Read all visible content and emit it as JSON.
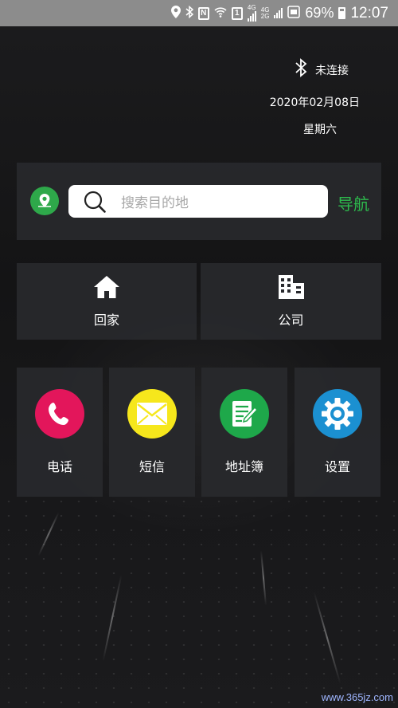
{
  "status_bar": {
    "icons": [
      "location-icon",
      "bluetooth-icon",
      "nfc-icon",
      "wifi-icon",
      "sim1-icon",
      "signal-4g-icon",
      "signal-4g-2g-icon",
      "data-saver-icon",
      "battery-icon"
    ],
    "net_a": "4G",
    "net_b_top": "4G",
    "net_b_bottom": "2G",
    "sim": "1",
    "nfc": "N",
    "battery_percent": "69%",
    "time": "12:07"
  },
  "connection": {
    "icon": "bluetooth-icon",
    "status": "未连接"
  },
  "date": "2020年02月08日",
  "weekday": "星期六",
  "navigation": {
    "location_icon": "location-pin-icon",
    "search_placeholder": "搜索目的地",
    "nav_button": "导航"
  },
  "shortcuts": [
    {
      "label": "回家",
      "icon": "home-icon"
    },
    {
      "label": "公司",
      "icon": "building-icon"
    }
  ],
  "apps": [
    {
      "label": "电话",
      "icon": "phone-icon",
      "color": "#e3165b"
    },
    {
      "label": "短信",
      "icon": "message-icon",
      "color": "#f6e71c"
    },
    {
      "label": "地址簿",
      "icon": "address-book-icon",
      "color": "#1ea84a"
    },
    {
      "label": "设置",
      "icon": "gear-icon",
      "color": "#1b90d1"
    }
  ],
  "watermark": "www.365jz.com"
}
